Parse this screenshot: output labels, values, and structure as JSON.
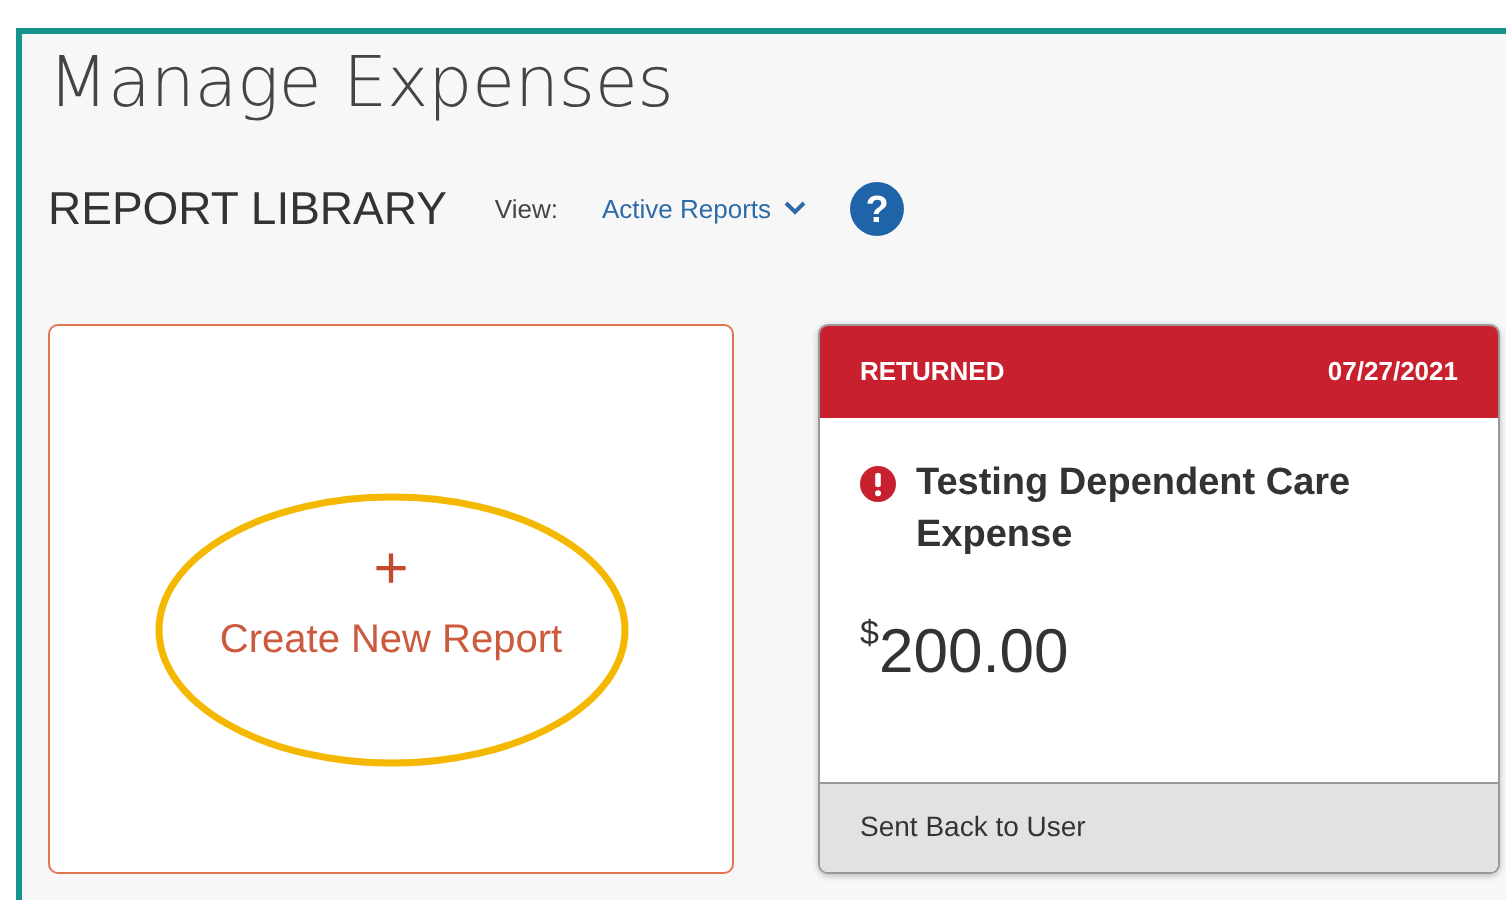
{
  "title": "Manage Expenses",
  "library": {
    "heading": "REPORT LIBRARY",
    "view_label": "View:",
    "view_value": "Active Reports",
    "help_icon": "?"
  },
  "create_card": {
    "plus": "+",
    "label": "Create New Report",
    "highlighted": true
  },
  "reports": [
    {
      "status": "RETURNED",
      "date": "07/27/2021",
      "alert": true,
      "name": "Testing Dependent Care Expense",
      "currency": "$",
      "amount": "200.00",
      "footer": "Sent Back to User"
    }
  ]
}
